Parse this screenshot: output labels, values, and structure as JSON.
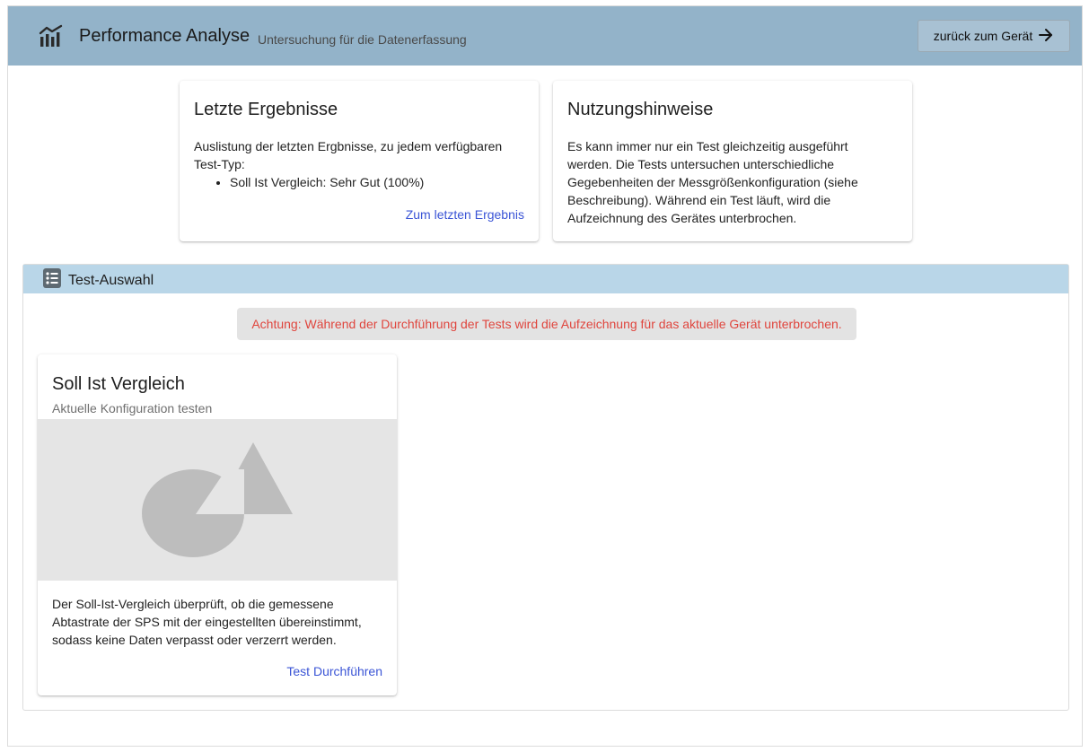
{
  "header": {
    "title": "Performance Analyse",
    "subtitle": "Untersuchung für die Datenerfassung",
    "back_button": "zurück zum Gerät",
    "app_icon": "chart-bars-icon",
    "back_icon": "arrow-right-icon"
  },
  "results_card": {
    "title": "Letzte Ergebnisse",
    "description": "Auslistung der letzten Ergbnisse, zu jedem verfügbaren Test-Typ:",
    "items": [
      "Soll Ist Vergleich: Sehr Gut (100%)"
    ],
    "link": "Zum letzten Ergebnis"
  },
  "hints_card": {
    "title": "Nutzungshinweise",
    "description": "Es kann immer nur ein Test gleichzeitig ausgeführt werden. Die Tests untersuchen unterschiedliche Gegebenheiten der Messgrößenkonfiguration (siehe Beschreibung). Während ein Test läuft, wird die Aufzeichnung des Gerätes unterbrochen."
  },
  "test_selection": {
    "title": "Test-Auswahl",
    "icon": "list-icon",
    "warning": "Achtung: Während der Durchführung der Tests wird die Aufzeichnung für das aktuelle Gerät unterbrochen.",
    "tests": [
      {
        "title": "Soll Ist Vergleich",
        "subtitle": "Aktuelle Konfiguration testen",
        "image_icon": "image-placeholder-icon",
        "description": "Der Soll-Ist-Vergleich überprüft, ob die gemessene Abtastrate der SPS mit der eingestellten übereinstimmt, sodass keine Daten verpasst oder verzerrt werden.",
        "action": "Test Durchführen"
      }
    ]
  },
  "colors": {
    "header_bg": "#93b3c9",
    "panel_header_bg": "#b9d6e8",
    "link": "#3b55d6",
    "warning_text": "#e0453d",
    "warning_bg": "#e3e3e3"
  }
}
